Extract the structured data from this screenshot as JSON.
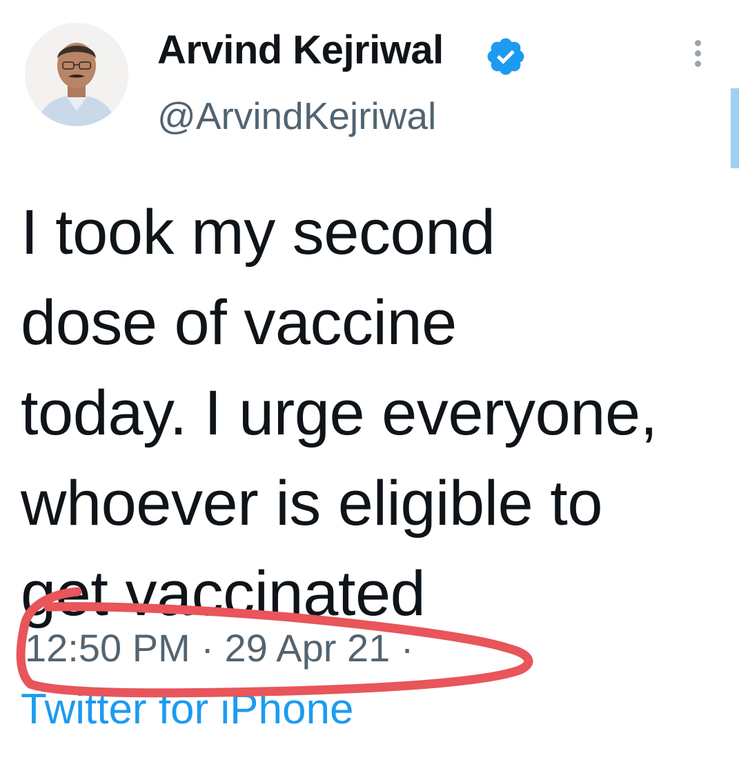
{
  "author": {
    "display_name": "Arvind Kejriwal",
    "handle": "@ArvindKejriwal",
    "verified": true
  },
  "tweet": {
    "lines": [
      "I took my second",
      "dose of vaccine",
      "today. I urge everyone,",
      "whoever is eligible to",
      "get vaccinated"
    ],
    "time": "12:50 PM",
    "separator": "·",
    "date": "29 Apr 21",
    "source": "Twitter for iPhone"
  },
  "icons": {
    "verified": "verified-badge-icon",
    "more": "more-vertical-icon"
  },
  "colors": {
    "verified_blue": "#1d9bf0",
    "annotation_red": "#e8555a",
    "meta_gray": "#536471"
  }
}
